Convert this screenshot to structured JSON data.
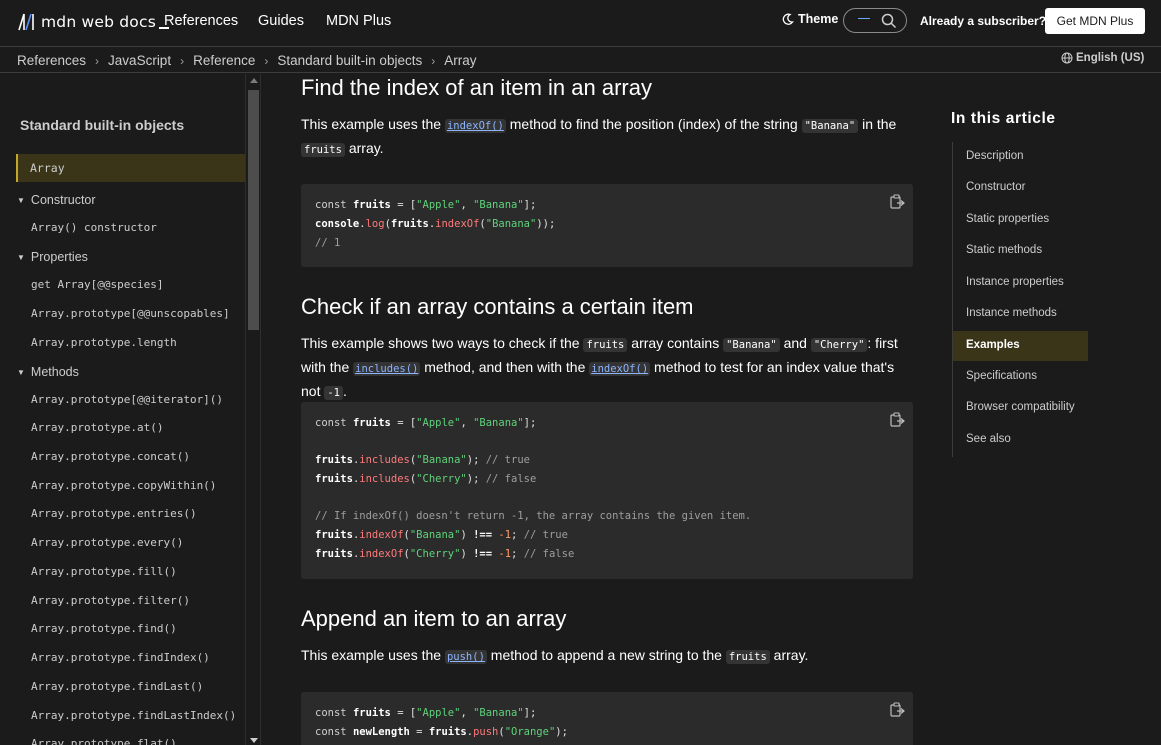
{
  "topnav": {
    "logo_text": "mdn web docs",
    "links": [
      "References",
      "Guides",
      "MDN Plus"
    ],
    "theme_label": "Theme",
    "subscriber_label": "Already a subscriber?",
    "get_plus_label": "Get MDN Plus"
  },
  "breadcrumbs": [
    "References",
    "JavaScript",
    "Reference",
    "Standard built-in objects",
    "Array"
  ],
  "language": "English (US)",
  "sidebar": {
    "heading": "Standard built-in objects",
    "active": "Array",
    "constructor_heading": "Constructor",
    "constructor_items": [
      "Array() constructor"
    ],
    "properties_heading": "Properties",
    "properties_items": [
      "get Array[@@species]",
      "Array.prototype[@@unscopables]",
      "Array.prototype.length"
    ],
    "methods_heading": "Methods",
    "methods_items": [
      "Array.prototype[@@iterator]()",
      "Array.prototype.at()",
      "Array.prototype.concat()",
      "Array.prototype.copyWithin()",
      "Array.prototype.entries()",
      "Array.prototype.every()",
      "Array.prototype.fill()",
      "Array.prototype.filter()",
      "Array.prototype.find()",
      "Array.prototype.findIndex()",
      "Array.prototype.findLast()",
      "Array.prototype.findLastIndex()",
      "Array.prototype.flat()"
    ]
  },
  "content": {
    "section1": {
      "title": "Find the index of an item in an array",
      "p_before": "This example uses the ",
      "p_link": "indexOf()",
      "p_mid": " method to find the position (index) of the string ",
      "p_code1": "\"Banana\"",
      "p_after": " in the",
      "p_code2": "fruits",
      "p_end": " array."
    },
    "section2": {
      "title": "Check if an array contains a certain item",
      "p1": "This example shows two ways to check if the ",
      "c1": "fruits",
      "p2": " array contains ",
      "c2": "\"Banana\"",
      "p3": " and ",
      "c3": "\"Cherry\"",
      "p4": ": first with the ",
      "l1": "includes()",
      "p5": " method, and then with the ",
      "l2": "indexOf()",
      "p6": " method to test for an index value that's not ",
      "c4": "-1",
      "p7": "."
    },
    "section3": {
      "title": "Append an item to an array",
      "p1": "This example uses the ",
      "l1": "push()",
      "p2": " method to append a new string to the ",
      "c1": "fruits",
      "p3": " array."
    }
  },
  "toc": {
    "title": "In this article",
    "items": [
      "Description",
      "Constructor",
      "Static properties",
      "Static methods",
      "Instance properties",
      "Instance methods",
      "Examples",
      "Specifications",
      "Browser compatibility",
      "See also"
    ],
    "active": "Examples"
  }
}
